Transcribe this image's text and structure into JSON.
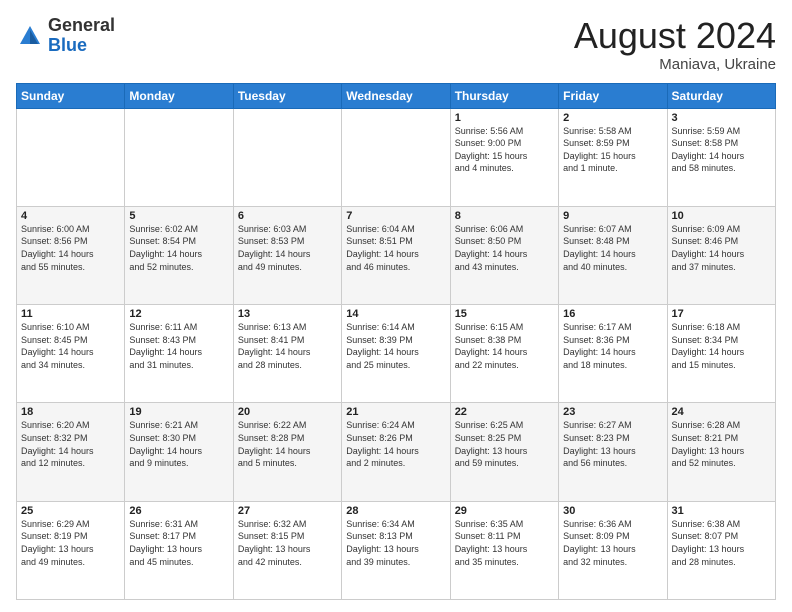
{
  "header": {
    "logo_general": "General",
    "logo_blue": "Blue",
    "month_year": "August 2024",
    "location": "Maniava, Ukraine"
  },
  "calendar": {
    "days_of_week": [
      "Sunday",
      "Monday",
      "Tuesday",
      "Wednesday",
      "Thursday",
      "Friday",
      "Saturday"
    ],
    "weeks": [
      [
        {
          "day": "",
          "info": ""
        },
        {
          "day": "",
          "info": ""
        },
        {
          "day": "",
          "info": ""
        },
        {
          "day": "",
          "info": ""
        },
        {
          "day": "1",
          "info": "Sunrise: 5:56 AM\nSunset: 9:00 PM\nDaylight: 15 hours\nand 4 minutes."
        },
        {
          "day": "2",
          "info": "Sunrise: 5:58 AM\nSunset: 8:59 PM\nDaylight: 15 hours\nand 1 minute."
        },
        {
          "day": "3",
          "info": "Sunrise: 5:59 AM\nSunset: 8:58 PM\nDaylight: 14 hours\nand 58 minutes."
        }
      ],
      [
        {
          "day": "4",
          "info": "Sunrise: 6:00 AM\nSunset: 8:56 PM\nDaylight: 14 hours\nand 55 minutes."
        },
        {
          "day": "5",
          "info": "Sunrise: 6:02 AM\nSunset: 8:54 PM\nDaylight: 14 hours\nand 52 minutes."
        },
        {
          "day": "6",
          "info": "Sunrise: 6:03 AM\nSunset: 8:53 PM\nDaylight: 14 hours\nand 49 minutes."
        },
        {
          "day": "7",
          "info": "Sunrise: 6:04 AM\nSunset: 8:51 PM\nDaylight: 14 hours\nand 46 minutes."
        },
        {
          "day": "8",
          "info": "Sunrise: 6:06 AM\nSunset: 8:50 PM\nDaylight: 14 hours\nand 43 minutes."
        },
        {
          "day": "9",
          "info": "Sunrise: 6:07 AM\nSunset: 8:48 PM\nDaylight: 14 hours\nand 40 minutes."
        },
        {
          "day": "10",
          "info": "Sunrise: 6:09 AM\nSunset: 8:46 PM\nDaylight: 14 hours\nand 37 minutes."
        }
      ],
      [
        {
          "day": "11",
          "info": "Sunrise: 6:10 AM\nSunset: 8:45 PM\nDaylight: 14 hours\nand 34 minutes."
        },
        {
          "day": "12",
          "info": "Sunrise: 6:11 AM\nSunset: 8:43 PM\nDaylight: 14 hours\nand 31 minutes."
        },
        {
          "day": "13",
          "info": "Sunrise: 6:13 AM\nSunset: 8:41 PM\nDaylight: 14 hours\nand 28 minutes."
        },
        {
          "day": "14",
          "info": "Sunrise: 6:14 AM\nSunset: 8:39 PM\nDaylight: 14 hours\nand 25 minutes."
        },
        {
          "day": "15",
          "info": "Sunrise: 6:15 AM\nSunset: 8:38 PM\nDaylight: 14 hours\nand 22 minutes."
        },
        {
          "day": "16",
          "info": "Sunrise: 6:17 AM\nSunset: 8:36 PM\nDaylight: 14 hours\nand 18 minutes."
        },
        {
          "day": "17",
          "info": "Sunrise: 6:18 AM\nSunset: 8:34 PM\nDaylight: 14 hours\nand 15 minutes."
        }
      ],
      [
        {
          "day": "18",
          "info": "Sunrise: 6:20 AM\nSunset: 8:32 PM\nDaylight: 14 hours\nand 12 minutes."
        },
        {
          "day": "19",
          "info": "Sunrise: 6:21 AM\nSunset: 8:30 PM\nDaylight: 14 hours\nand 9 minutes."
        },
        {
          "day": "20",
          "info": "Sunrise: 6:22 AM\nSunset: 8:28 PM\nDaylight: 14 hours\nand 5 minutes."
        },
        {
          "day": "21",
          "info": "Sunrise: 6:24 AM\nSunset: 8:26 PM\nDaylight: 14 hours\nand 2 minutes."
        },
        {
          "day": "22",
          "info": "Sunrise: 6:25 AM\nSunset: 8:25 PM\nDaylight: 13 hours\nand 59 minutes."
        },
        {
          "day": "23",
          "info": "Sunrise: 6:27 AM\nSunset: 8:23 PM\nDaylight: 13 hours\nand 56 minutes."
        },
        {
          "day": "24",
          "info": "Sunrise: 6:28 AM\nSunset: 8:21 PM\nDaylight: 13 hours\nand 52 minutes."
        }
      ],
      [
        {
          "day": "25",
          "info": "Sunrise: 6:29 AM\nSunset: 8:19 PM\nDaylight: 13 hours\nand 49 minutes."
        },
        {
          "day": "26",
          "info": "Sunrise: 6:31 AM\nSunset: 8:17 PM\nDaylight: 13 hours\nand 45 minutes."
        },
        {
          "day": "27",
          "info": "Sunrise: 6:32 AM\nSunset: 8:15 PM\nDaylight: 13 hours\nand 42 minutes."
        },
        {
          "day": "28",
          "info": "Sunrise: 6:34 AM\nSunset: 8:13 PM\nDaylight: 13 hours\nand 39 minutes."
        },
        {
          "day": "29",
          "info": "Sunrise: 6:35 AM\nSunset: 8:11 PM\nDaylight: 13 hours\nand 35 minutes."
        },
        {
          "day": "30",
          "info": "Sunrise: 6:36 AM\nSunset: 8:09 PM\nDaylight: 13 hours\nand 32 minutes."
        },
        {
          "day": "31",
          "info": "Sunrise: 6:38 AM\nSunset: 8:07 PM\nDaylight: 13 hours\nand 28 minutes."
        }
      ]
    ]
  }
}
